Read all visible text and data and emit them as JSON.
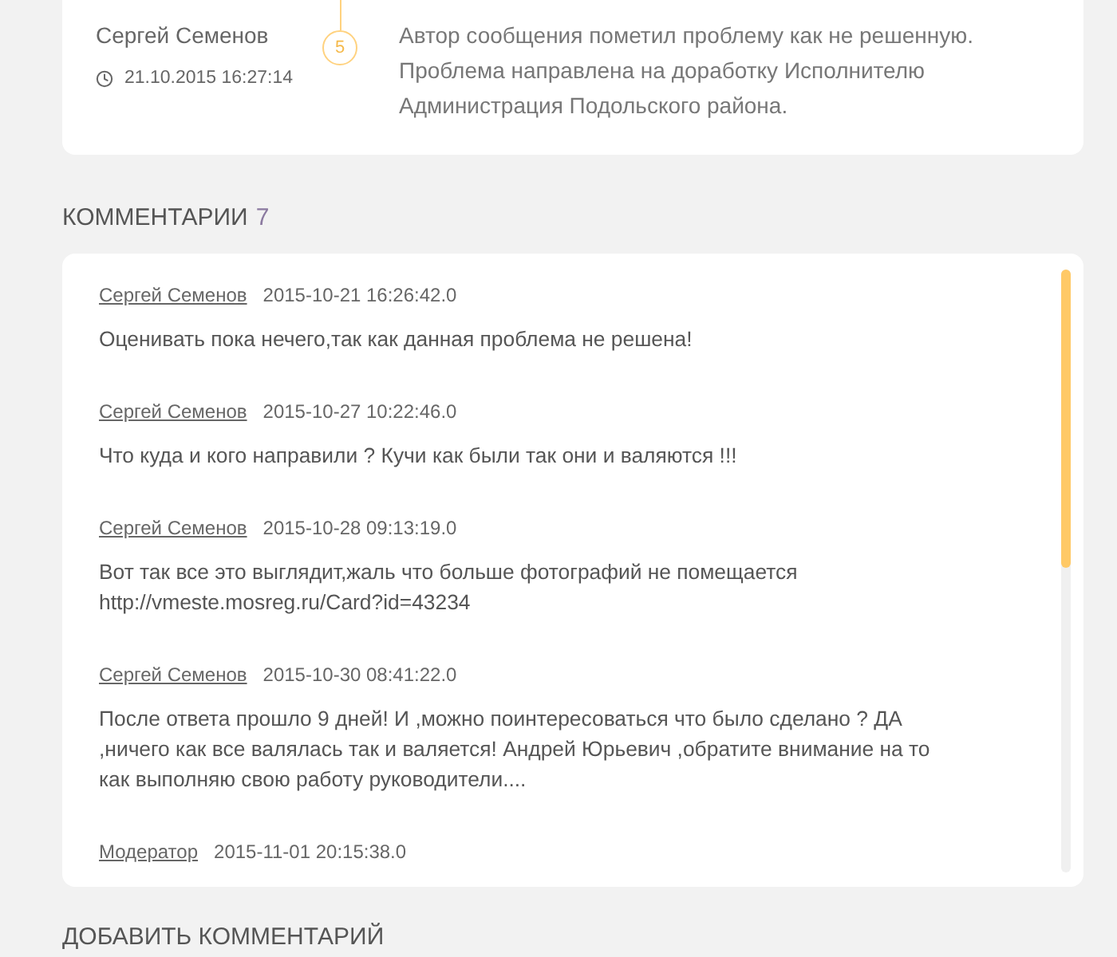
{
  "history_entry": {
    "author": "Сергей Семенов",
    "timestamp": "21.10.2015 16:27:14",
    "step": "5",
    "message": "Автор сообщения пометил проблему как не решенную. Проблема направлена на доработку Исполнителю Администрация Подольского района."
  },
  "comments_section": {
    "title": "КОММЕНТАРИИ",
    "count": "7",
    "comments": [
      {
        "author": "Сергей Семенов",
        "date": "2015-10-21 16:26:42.0",
        "text": "Оценивать пока нечего,так как данная проблема не решена!"
      },
      {
        "author": "Сергей Семенов",
        "date": "2015-10-27 10:22:46.0",
        "text": "Что куда и кого направили ? Кучи как были так они и валяются !!!"
      },
      {
        "author": "Сергей Семенов",
        "date": "2015-10-28 09:13:19.0",
        "text": "Вот так все это выглядит,жаль что больше фотографий не помещается http://vmeste.mosreg.ru/Card?id=43234"
      },
      {
        "author": "Сергей Семенов",
        "date": "2015-10-30 08:41:22.0",
        "text": "После ответа прошло 9 дней! И ,можно поинтересоваться что было сделано ? ДА ,ничего как все валялась так и валяется! Андрей Юрьевич ,обратите внимание на то как выполняю свою работу руководители...."
      },
      {
        "author": "Модератор",
        "date": "2015-11-01 20:15:38.0"
      }
    ]
  },
  "add_comment_section": {
    "title": "ДОБАВИТЬ КОММЕНТАРИЙ"
  }
}
